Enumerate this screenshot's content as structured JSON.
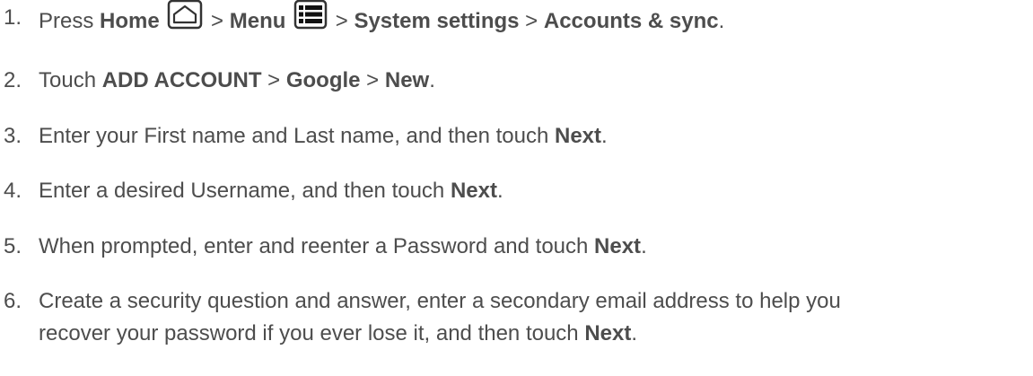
{
  "steps": [
    {
      "number": "1.",
      "t0": "Press ",
      "home": "Home",
      "sep1": " > ",
      "menu": "Menu",
      "sep2": " > ",
      "system_settings": "System settings",
      "sep3": " > ",
      "accounts_sync": "Accounts & sync",
      "end": ".",
      "icons": [
        "home-key-icon",
        "menu-key-icon"
      ]
    },
    {
      "number": "2.",
      "t0": "Touch ",
      "add_account": "ADD ACCOUNT",
      "sep1": " > ",
      "google": "Google",
      "sep2": " > ",
      "new": "New",
      "end": "."
    },
    {
      "number": "3.",
      "t0": "Enter your First name and Last name, and then touch ",
      "next": "Next",
      "end": "."
    },
    {
      "number": "4.",
      "t0": "Enter a desired Username, and then touch ",
      "next": "Next",
      "end": "."
    },
    {
      "number": "5.",
      "t0": "When prompted, enter and reenter a Password and touch ",
      "next": "Next",
      "end": "."
    },
    {
      "number": "6.",
      "line1": "Create a security question and answer, enter a secondary email address to help you",
      "t0": "recover your password if you ever lose it, and then touch ",
      "next": "Next",
      "end": "."
    }
  ],
  "colors": {
    "text": "#4d4d4d",
    "icon": "#333333"
  }
}
